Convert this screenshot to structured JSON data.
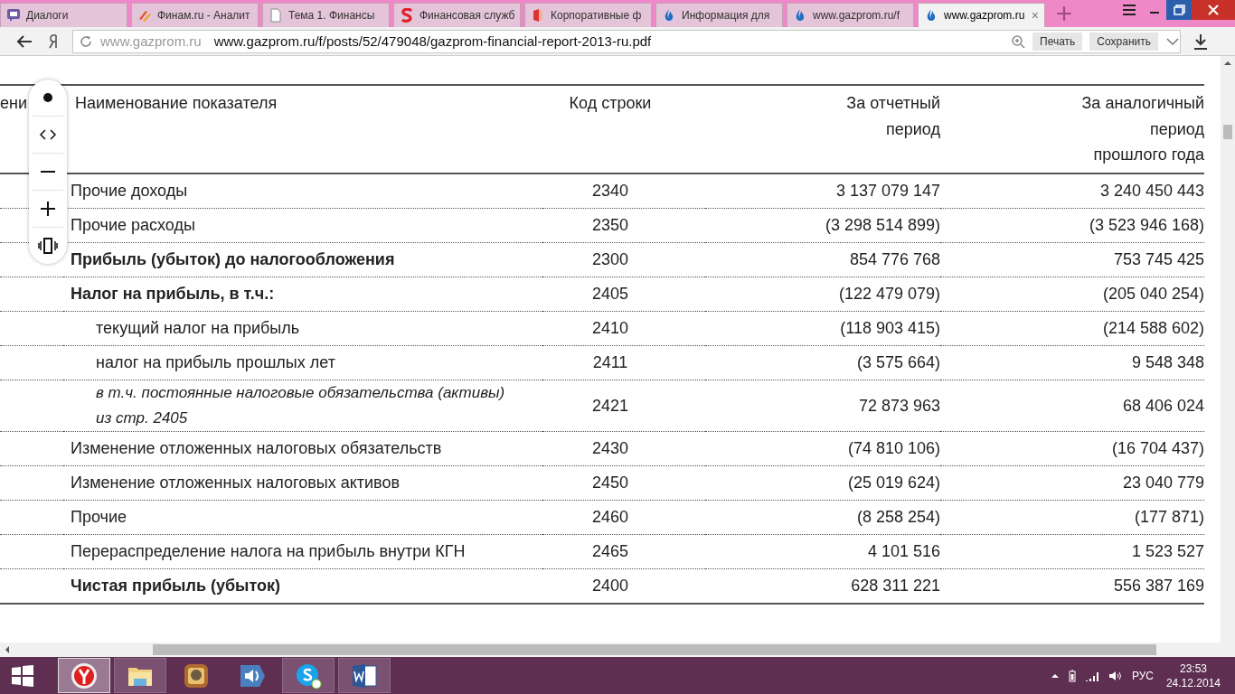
{
  "tabs": [
    {
      "title": "Диалоги",
      "kind": "chat",
      "selected": false
    },
    {
      "title": "Финам.ru - Аналит",
      "kind": "finam",
      "selected": false
    },
    {
      "title": "Тема 1. Финансы",
      "kind": "doc",
      "selected": false
    },
    {
      "title": "Финансовая служб",
      "kind": "s",
      "selected": false
    },
    {
      "title": "Корпоративные ф",
      "kind": "corp",
      "selected": false
    },
    {
      "title": "Информация для",
      "kind": "flame",
      "selected": false
    },
    {
      "title": "www.gazprom.ru/f",
      "kind": "flame",
      "selected": false
    },
    {
      "title": "www.gazprom.ru",
      "kind": "flame",
      "selected": true,
      "close": "×"
    }
  ],
  "address_bar": {
    "host": "www.gazprom.ru",
    "url": "www.gazprom.ru/f/posts/52/479048/gazprom-financial-report-2013-ru.pdf",
    "buttons": [
      "Печать",
      "Сохранить"
    ]
  },
  "table": {
    "columns": [
      "ени",
      "Наименование показателя",
      "Код строки",
      "За отчетный период",
      "За аналогичный период прошлого года"
    ],
    "rows": [
      {
        "kind": "normal",
        "name": "Прочие доходы",
        "code": "2340",
        "current": "3 137 079 147",
        "previous": "3 240 450 443"
      },
      {
        "kind": "normal",
        "name": "Прочие расходы",
        "code": "2350",
        "current": "(3 298 514 899)",
        "previous": "(3 523 946 168)"
      },
      {
        "kind": "bold",
        "name": "Прибыль (убыток) до налогообложения",
        "code": "2300",
        "current": "854 776 768",
        "previous": "753 745 425"
      },
      {
        "kind": "bold",
        "name": "Налог на прибыль, в т.ч.:",
        "code": "2405",
        "current": "(122 479 079)",
        "previous": "(205 040 254)"
      },
      {
        "kind": "indent",
        "name": "текущий налог на прибыль",
        "code": "2410",
        "current": "(118 903 415)",
        "previous": "(214 588 602)"
      },
      {
        "kind": "indent",
        "name": "налог на прибыль прошлых лет",
        "code": "2411",
        "current": "(3 575 664)",
        "previous": "9 548 348"
      },
      {
        "kind": "italic",
        "name": "в т.ч. постоянные налоговые обязательства (активы) из стр. 2405",
        "code": "2421",
        "current": "72 873 963",
        "previous": "68 406 024"
      },
      {
        "kind": "normal",
        "name": "Изменение отложенных налоговых обязательств",
        "code": "2430",
        "current": "(74 810 106)",
        "previous": "(16 704 437)"
      },
      {
        "kind": "normal",
        "name": "Изменение отложенных налоговых активов",
        "code": "2450",
        "current": "(25 019 624)",
        "previous": "23 040 779"
      },
      {
        "kind": "normal",
        "name": "Прочие",
        "code": "2460",
        "current": "(8 258 254)",
        "previous": "(177 871)"
      },
      {
        "kind": "normal",
        "name": "Перераспределение налога на прибыль внутри КГН",
        "code": "2465",
        "current": "4 101 516",
        "previous": "1 523 527"
      },
      {
        "kind": "bold",
        "name": "Чистая прибыль (убыток)",
        "code": "2400",
        "current": "628 311 221",
        "previous": "556 387 169"
      }
    ]
  },
  "taskbar": {
    "apps": [
      {
        "kind": "yandex",
        "running": true,
        "selected": true
      },
      {
        "kind": "folder",
        "running": true,
        "selected": false
      },
      {
        "kind": "photo",
        "running": false,
        "selected": false
      },
      {
        "kind": "speaker",
        "running": false,
        "selected": false
      },
      {
        "kind": "skype",
        "running": true,
        "selected": false
      },
      {
        "kind": "word",
        "running": true,
        "selected": false
      }
    ],
    "language": "РУС",
    "time": "23:53",
    "date": "24.12.2014"
  }
}
